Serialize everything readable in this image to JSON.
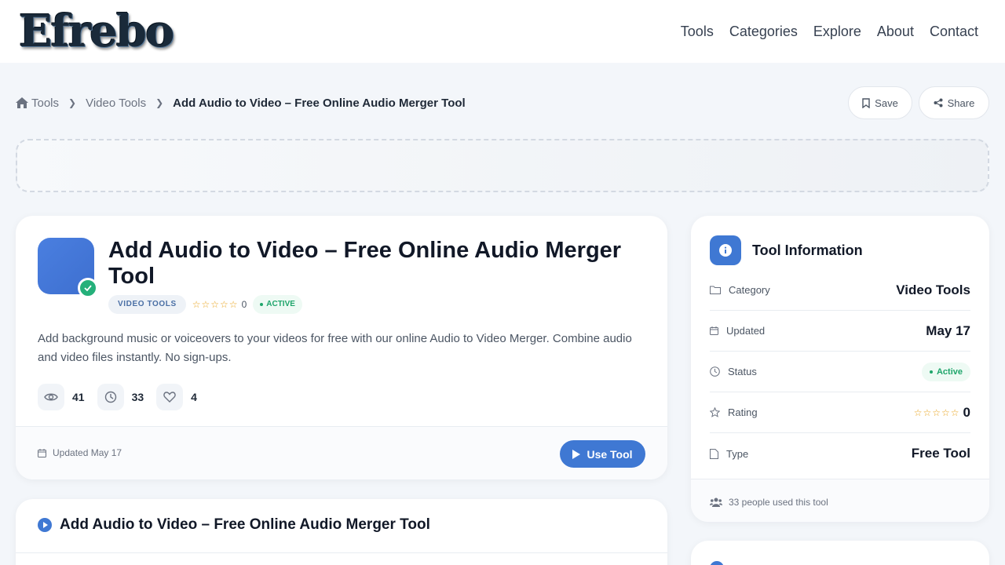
{
  "header": {
    "logo_text": "Efrebo",
    "nav": [
      {
        "label": "Tools"
      },
      {
        "label": "Categories"
      },
      {
        "label": "Explore"
      },
      {
        "label": "About"
      },
      {
        "label": "Contact"
      }
    ]
  },
  "breadcrumb": {
    "items": [
      "Tools",
      "Video Tools"
    ],
    "current": "Add Audio to Video – Free Online Audio Merger Tool"
  },
  "actions": {
    "save_label": "Save",
    "share_label": "Share"
  },
  "tool": {
    "title": "Add Audio to Video – Free Online Audio Merger Tool",
    "category_badge": "VIDEO TOOLS",
    "stars": "☆☆☆☆☆",
    "rating_count": "0",
    "status_badge": "ACTIVE",
    "description": "Add background music or voiceovers to your videos for free with our online Audio to Video Merger. Combine audio and video files instantly. No sign-ups.",
    "stats": {
      "views": "41",
      "uses": "33",
      "likes": "4"
    },
    "updated_text": "Updated May 17",
    "use_tool_label": "Use Tool"
  },
  "section": {
    "title": "Add Audio to Video – Free Online Audio Merger Tool"
  },
  "info_panel": {
    "title": "Tool Information",
    "rows": [
      {
        "label": "Category",
        "value": "Video Tools"
      },
      {
        "label": "Updated",
        "value": "May 17"
      },
      {
        "label": "Status",
        "value": "Active"
      },
      {
        "label": "Rating",
        "stars": "☆☆☆☆☆",
        "value": "0"
      },
      {
        "label": "Type",
        "value": "Free Tool"
      }
    ],
    "footer": "33 people used this tool"
  },
  "colors": {
    "accent": "#3f78d3",
    "success": "#1fa56b",
    "star": "#e8a21a"
  }
}
